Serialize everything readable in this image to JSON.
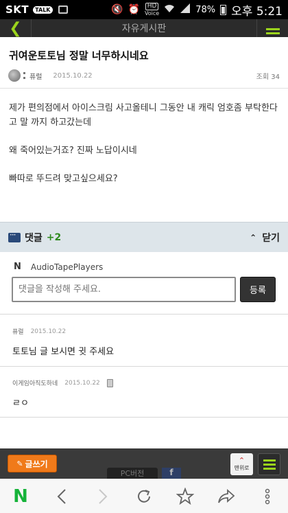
{
  "statusbar": {
    "carrier": "SKT",
    "talk_badge": "TALK",
    "hd_label": "HD",
    "voice_label": "Voice",
    "battery": "78%",
    "time": "오후 5:21"
  },
  "appbar": {
    "title": "자유게시판"
  },
  "post": {
    "title": "귀여운토토님 정말 너무하시네요",
    "author": "퓨럴",
    "date": "2015.10.22",
    "views_label": "조회",
    "views": "34",
    "paragraphs": [
      "제가 편의점에서 아이스크림 사고올테니 그동안 내 캐릭 엄호좀 부탁한다고 말 까지 하고갔는데",
      "왜 죽어있는거죠? 진짜 노답이시네",
      "빠따로 뚜드려 맞고싶으세요?"
    ]
  },
  "comments": {
    "label": "댓글",
    "count": "+2",
    "close_label": "닫기",
    "form": {
      "user_initial": "N",
      "username": "AudioTapePlayers",
      "placeholder": "댓글을 작성해 주세요.",
      "submit_label": "등록"
    },
    "items": [
      {
        "author": "퓨럴",
        "date": "2015.10.22",
        "text": "토토님 글 보시면 귓 주세요",
        "mobile": false
      },
      {
        "author": "이게임아직도하네",
        "date": "2015.10.22",
        "text": "ㄹㅇ",
        "mobile": true
      }
    ]
  },
  "bottombar": {
    "write_label": "글쓰기",
    "pc_label": "PC버전",
    "fb_label": "f",
    "top_label": "맨위로"
  },
  "browser": {
    "logo": "N"
  },
  "colors": {
    "accent_green": "#9bd31c",
    "write_orange": "#f07a1a",
    "comment_count_green": "#2f8a1f"
  }
}
